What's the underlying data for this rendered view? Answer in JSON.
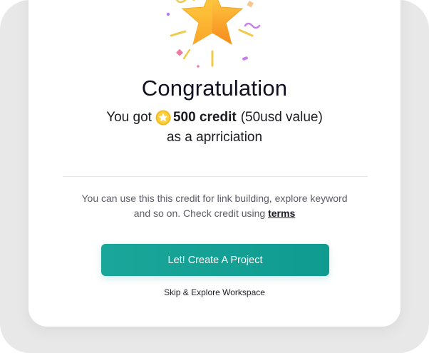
{
  "modal": {
    "title": "Congratulation",
    "credit_prefix": "You got",
    "credit_amount": "500 credit",
    "credit_value": "(50usd value)",
    "credit_suffix": "as a aprriciation",
    "info_text": "You can use this this credit for link building, explore keyword and so on. Check credit using",
    "info_link": "terms",
    "primary_button": "Let! Create A Project",
    "secondary_link": "Skip & Explore Workspace"
  },
  "icons": {
    "celebration": "star-confetti-icon",
    "coin": "coin-star-icon"
  },
  "colors": {
    "accent": "#12a193",
    "star": "#f7a826",
    "confetti_purple": "#c77dea",
    "confetti_pink": "#f07aa0",
    "confetti_yellow": "#f2c94c"
  }
}
